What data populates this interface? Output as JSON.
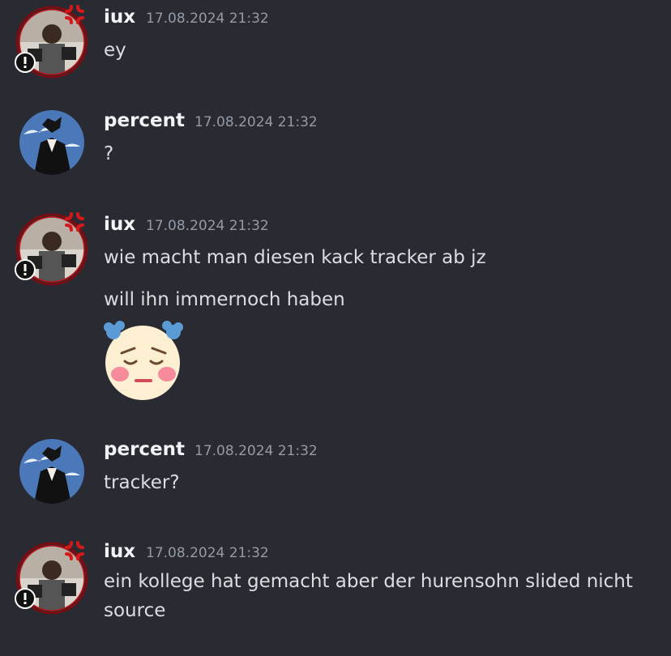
{
  "messages": [
    {
      "author": "iux",
      "timestamp": "17.08.2024 21:32",
      "lines": [
        "ey"
      ]
    },
    {
      "author": "percent",
      "timestamp": "17.08.2024 21:32",
      "lines": [
        "?"
      ]
    },
    {
      "author": "iux",
      "timestamp": "17.08.2024 21:32",
      "lines": [
        "wie macht man diesen kack tracker ab jz",
        "will ihn immernoch haben"
      ],
      "emoji": "pensive-clown-bow-emoji"
    },
    {
      "author": "percent",
      "timestamp": "17.08.2024 21:32",
      "lines": [
        "tracker?"
      ]
    },
    {
      "author": "iux",
      "timestamp": "17.08.2024 21:32",
      "lines": [
        "ein kollege hat gemacht aber der hurensohn slided nicht",
        "source"
      ]
    }
  ],
  "colors": {
    "background": "#2a2a33",
    "username": "#f2f3f5",
    "timestamp": "#949ba4",
    "text": "#dbdee1",
    "decoration_red": "#c0141c"
  },
  "icons": {
    "iux_avatar_decoration": "anger-symbol-icon",
    "iux_badge": "exclamation-badge-icon"
  }
}
